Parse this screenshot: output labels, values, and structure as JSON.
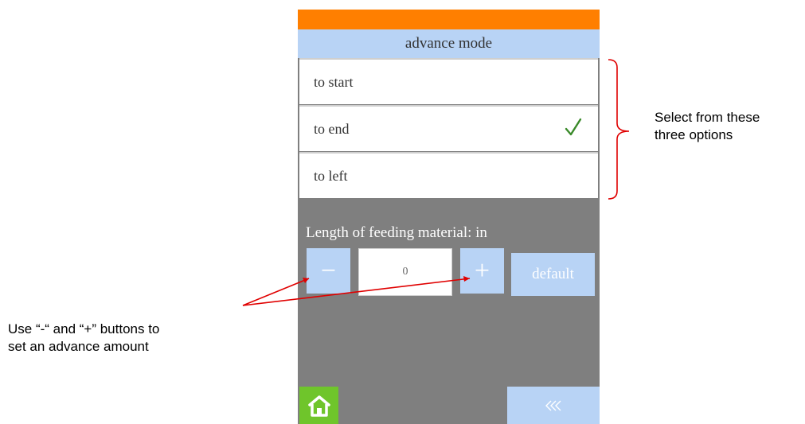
{
  "screen": {
    "title": "advance mode",
    "options": [
      {
        "label": "to start",
        "selected": false
      },
      {
        "label": "to end",
        "selected": true
      },
      {
        "label": "to left",
        "selected": false
      }
    ],
    "length_label": "Length of feeding material: in",
    "minus_label": "−",
    "value": "0",
    "plus_label": "+",
    "default_label": "default",
    "back_label": "«‹"
  },
  "annotations": {
    "options_note": [
      "Select from these",
      "three options"
    ],
    "buttons_note": [
      "Use “-“ and “+” buttons to",
      "set an advance amount"
    ]
  },
  "colors": {
    "header_orange": "#ff7f00",
    "title_blue": "#b8d3f5",
    "panel_gray": "#7f7f7f",
    "home_green": "#6fc52b",
    "check_green": "#3a8a2a",
    "arrow_red": "#e00000"
  },
  "icons": {
    "check": "check-icon",
    "home": "home-icon",
    "back": "double-chevron-left-icon"
  }
}
